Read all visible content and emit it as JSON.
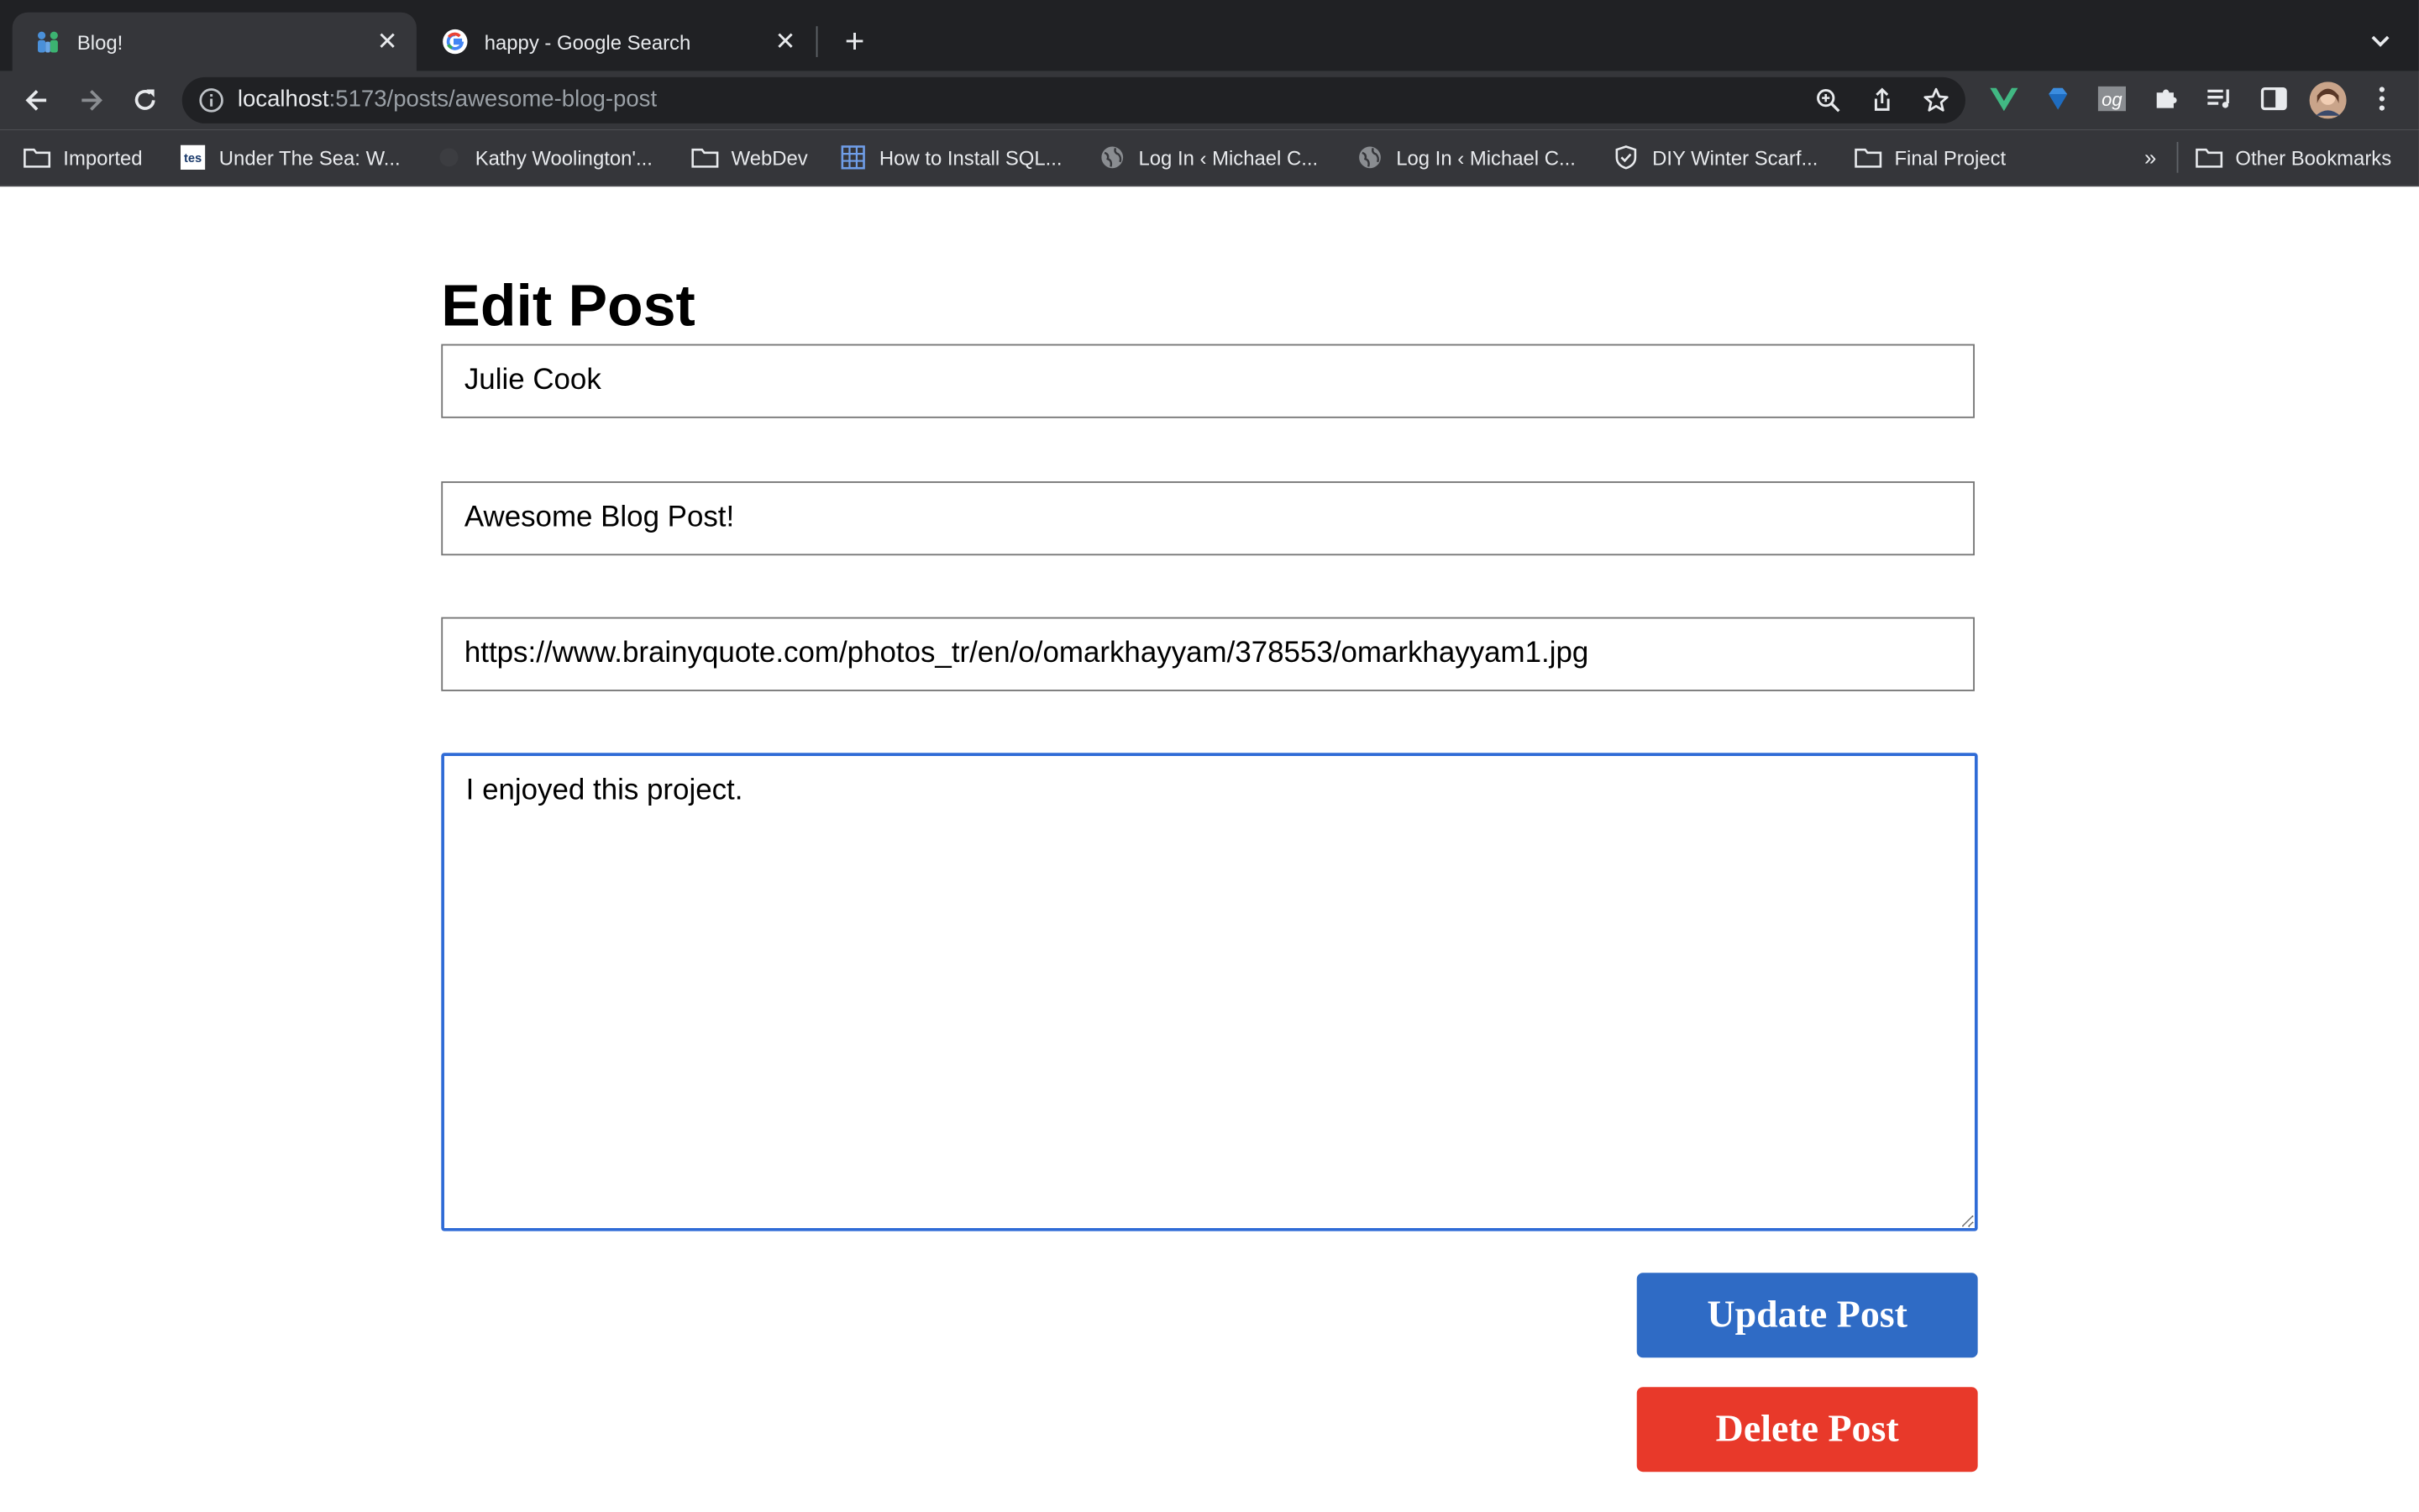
{
  "browser": {
    "tabs": [
      {
        "title": "Blog!",
        "favicon": "people-icon",
        "active": true
      },
      {
        "title": "happy - Google Search",
        "favicon": "google-icon",
        "active": false
      }
    ],
    "address": {
      "host": "localhost",
      "path": ":5173/posts/awesome-blog-post"
    },
    "bookmarks": [
      {
        "label": "Imported",
        "icon": "folder-icon"
      },
      {
        "label": "Under The Sea: W...",
        "icon": "tes-icon"
      },
      {
        "label": "Kathy Woolington'...",
        "icon": "blank-icon"
      },
      {
        "label": "WebDev",
        "icon": "folder-icon"
      },
      {
        "label": "How to Install SQL...",
        "icon": "grid-icon"
      },
      {
        "label": "Log In ‹ Michael C...",
        "icon": "globe-icon"
      },
      {
        "label": "Log In ‹ Michael C...",
        "icon": "globe-icon"
      },
      {
        "label": "DIY Winter Scarf...",
        "icon": "shield-icon"
      },
      {
        "label": "Final Project",
        "icon": "folder-icon"
      }
    ],
    "bookmarks_overflow": "»",
    "other_bookmarks": "Other Bookmarks"
  },
  "page": {
    "heading": "Edit Post",
    "author_value": "Julie Cook",
    "title_value": "Awesome Blog Post!",
    "image_url_value": "https://www.brainyquote.com/photos_tr/en/o/omarkhayyam/378553/omarkhayyam1.jpg",
    "body_value": "I enjoyed this project.",
    "update_label": "Update Post",
    "delete_label": "Delete Post"
  },
  "colors": {
    "update_button": "#2f6bc5",
    "delete_button": "#e8392a",
    "focus_border": "#2f6bd6"
  }
}
